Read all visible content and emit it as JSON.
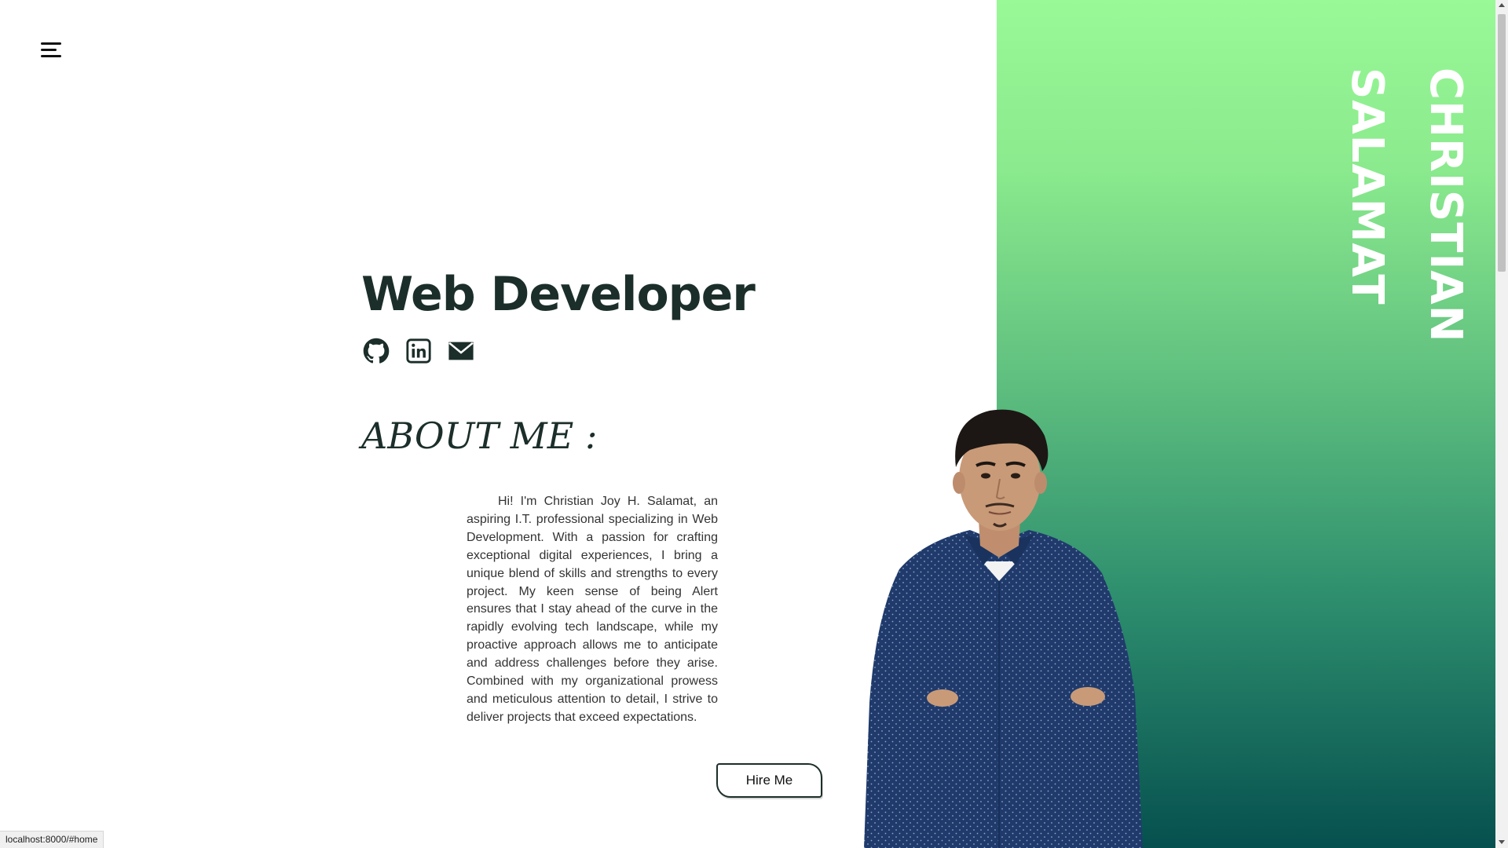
{
  "nav": {
    "menu_icon": "hamburger-menu-icon"
  },
  "hero": {
    "headline": "Web Developer",
    "vertical_name": "CHRISTIAN SALAMAT",
    "socials": [
      {
        "icon": "github-icon"
      },
      {
        "icon": "linkedin-icon"
      },
      {
        "icon": "mail-icon"
      }
    ]
  },
  "about": {
    "title": "ABOUT ME :",
    "text": "Hi! I'm Christian Joy H. Salamat, an aspiring I.T. professional specializing in Web Development. With a passion for crafting exceptional digital experiences, I bring a unique blend of skills and strengths to every project. My keen sense of being Alert ensures that I stay ahead of the curve in the rapidly evolving tech landscape, while my proactive approach allows me to anticipate and address challenges before they arise. Combined with my organizational prowess and meticulous attention to detail, I strive to deliver projects that exceed expectations.",
    "hire_label": "Hire Me"
  },
  "status_bar": {
    "url": "localhost:8000/#home"
  },
  "colors": {
    "gradient_top": "#99f997",
    "gradient_bottom": "#06504f",
    "heading": "#1b2e2a",
    "shirt": "#1f3a6b"
  }
}
